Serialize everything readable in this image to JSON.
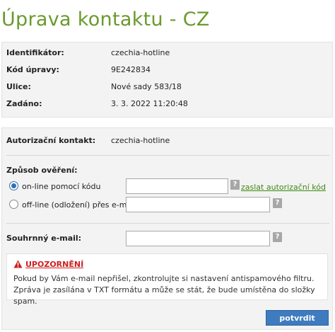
{
  "page_title": "Úprava kontaktu - CZ",
  "info": {
    "rows": [
      {
        "label": "Identifikátor:",
        "value": "czechia-hotline"
      },
      {
        "label": "Kód úpravy:",
        "value": "9E242834"
      },
      {
        "label": "Ulice:",
        "value": "Nové sady 583/18"
      },
      {
        "label": "Zadáno:",
        "value": "3. 3. 2022 11:20:48"
      }
    ]
  },
  "form": {
    "auth_contact_label": "Autorizační kontakt:",
    "auth_contact_value": "czechia-hotline",
    "verification_label": "Způsob ověření:",
    "options": [
      {
        "label": "on-line pomocí kódu",
        "selected": true,
        "input_value": "",
        "help": "?"
      },
      {
        "label": "off-line (odložení) přes e-mail",
        "selected": false,
        "input_value": "",
        "help": "?"
      }
    ],
    "send_code_link": "zaslat autorizační kód",
    "summary_email_label": "Souhrnný e-mail:",
    "summary_email_value": "",
    "summary_help": "?"
  },
  "warning": {
    "title": "UPOZORNĚNÍ",
    "text": "Pokud by Vám e-mail nepřišel, zkontrolujte si nastavení antispamového filtru. Zpráva je zasílána v TXT formátu a může se stát, že bude umístěna do složky spam.",
    "icon": "warning-triangle-icon"
  },
  "submit_label": "potvrdit",
  "colors": {
    "title": "#6a9a2e",
    "link": "#3d8a14",
    "warning": "#cc1f1f",
    "button": "#3f7bbf"
  }
}
